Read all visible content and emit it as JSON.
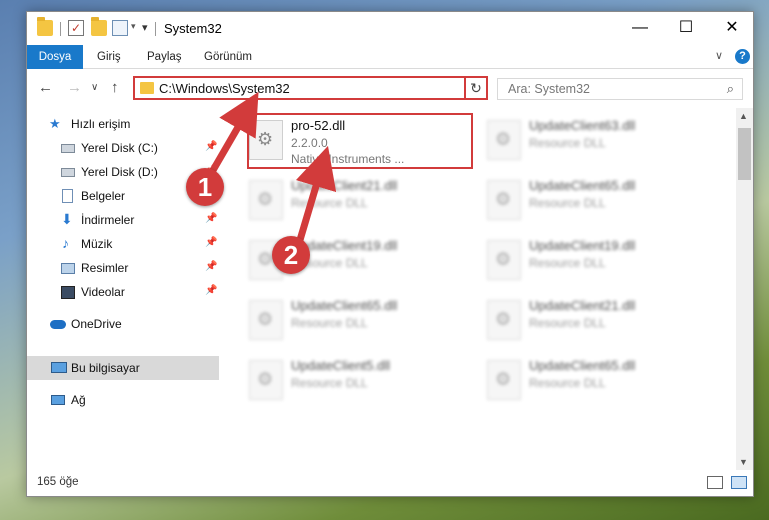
{
  "window": {
    "title": "System32",
    "caption": {
      "minimize": "—",
      "maximize": "☐",
      "close": "✕"
    }
  },
  "ribbon": {
    "tabs": [
      "Dosya",
      "Giriş",
      "Paylaş",
      "Görünüm"
    ],
    "active_tab": "Dosya",
    "expand": "∨",
    "help": "?"
  },
  "nav": {
    "back": "←",
    "forward": "→",
    "recent": "∨",
    "up": "↑",
    "address": "C:\\Windows\\System32",
    "address_dropdown": "∨",
    "refresh": "↻",
    "search_placeholder": "Ara: System32",
    "search_icon": "⌕"
  },
  "sidebar": {
    "items": [
      {
        "label": "Hızlı erişim",
        "icon": "star-icon"
      },
      {
        "label": "Yerel Disk (C:)",
        "icon": "drive-icon",
        "pinned": true
      },
      {
        "label": "Yerel Disk (D:)",
        "icon": "drive-icon",
        "pinned": true
      },
      {
        "label": "Belgeler",
        "icon": "document-icon",
        "pinned": true
      },
      {
        "label": "İndirmeler",
        "icon": "download-icon",
        "pinned": true
      },
      {
        "label": "Müzik",
        "icon": "music-icon",
        "pinned": true
      },
      {
        "label": "Resimler",
        "icon": "pictures-icon",
        "pinned": true
      },
      {
        "label": "Videolar",
        "icon": "video-icon",
        "pinned": true
      },
      {
        "label": "OneDrive",
        "icon": "cloud-icon"
      },
      {
        "label": "Bu bilgisayar",
        "icon": "computer-icon",
        "selected": true
      },
      {
        "label": "Ağ",
        "icon": "network-icon"
      }
    ],
    "pin_glyph": "📌"
  },
  "files": [
    {
      "name": "pro-52.dll",
      "version": "2.2.0.0",
      "company": "Native Instruments ...",
      "highlighted": true
    },
    {
      "name": "UpdateClient63.dll",
      "version": "Resource DLL"
    },
    {
      "name": "UpdateClient21.dll",
      "version": "Resource DLL"
    },
    {
      "name": "UpdateClient65.dll",
      "version": "Resource DLL"
    },
    {
      "name": "UpdateClient19.dll",
      "version": "Resource DLL"
    },
    {
      "name": "UpdateClient19.dll",
      "version": "Resource DLL"
    },
    {
      "name": "UpdateClient65.dll",
      "version": "Resource DLL"
    },
    {
      "name": "UpdateClient21.dll",
      "version": "Resource DLL"
    },
    {
      "name": "UpdateClient5.dll",
      "version": "Resource DLL"
    },
    {
      "name": "UpdateClient65.dll",
      "version": "Resource DLL"
    }
  ],
  "status": {
    "count": "165 öğe"
  },
  "annotations": {
    "step1": "1",
    "step2": "2",
    "color": "#d23b3b"
  }
}
